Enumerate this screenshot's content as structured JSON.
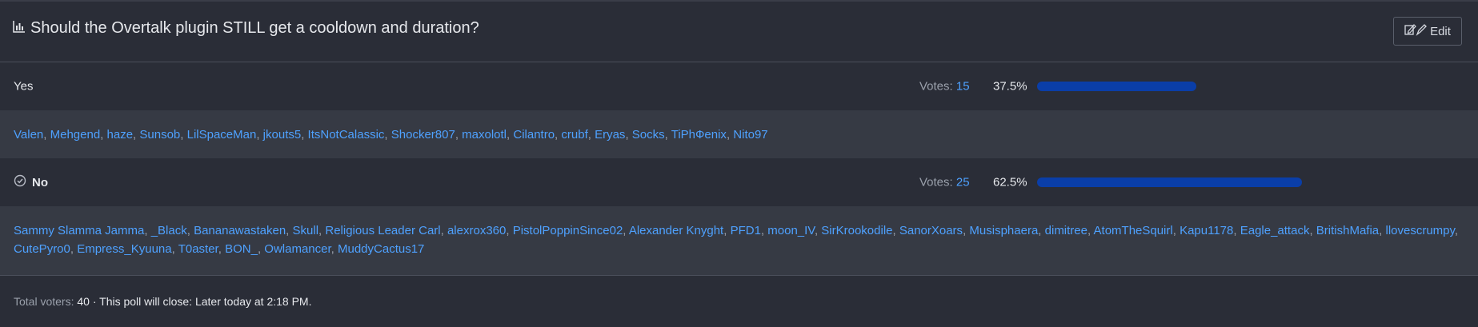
{
  "poll": {
    "title": "Should the Overtalk plugin STILL get a cooldown and duration?",
    "edit_label": "Edit",
    "votes_label": "Votes:",
    "options": [
      {
        "label": "Yes",
        "votes": "15",
        "percent": "37.5%",
        "fraction": 0.375,
        "voted_by_me": false,
        "voters": [
          "Valen",
          "Mehgend",
          "haze",
          "Sunsob",
          "LilSpaceMan",
          "jkouts5",
          "ItsNotCalassic",
          "Shocker807",
          "maxolotl",
          "Cilantro",
          "crubf",
          "Eryas",
          "Socks",
          "TiPhФenix",
          "Nito97"
        ]
      },
      {
        "label": "No",
        "votes": "25",
        "percent": "62.5%",
        "fraction": 0.625,
        "voted_by_me": true,
        "voters": [
          "Sammy Slamma Jamma",
          "_Black",
          "Bananawastaken",
          "Skull",
          "Religious Leader Carl",
          "alexrox360",
          "PistolPoppinSince02",
          "Alexander Knyght",
          "PFD1",
          "moon_IV",
          "SirKrookodile",
          "SanorXoars",
          "Musisphaera",
          "dimitree",
          "AtomTheSquirl",
          "Kapu1178",
          "Eagle_attack",
          "BritishMafia",
          "llovescrumpy",
          "CutePyro0",
          "Empress_Kyuuna",
          "T0aster",
          "BON_",
          "Owlamancer",
          "MuddyCactus17"
        ]
      }
    ],
    "footer": {
      "total_label": "Total voters:",
      "total": "40",
      "close_text": "· This poll will close: Later today at 2:18 PM."
    }
  },
  "colors": {
    "bar_fill": "#0a3ea8",
    "link": "#4ea1ff",
    "background": "#2a2d37",
    "voter_row_background": "#363a44"
  },
  "icons": {
    "title_icon": "bar-chart-icon",
    "edit_icon": "edit-icon",
    "voted_icon": "check-circle-icon"
  }
}
